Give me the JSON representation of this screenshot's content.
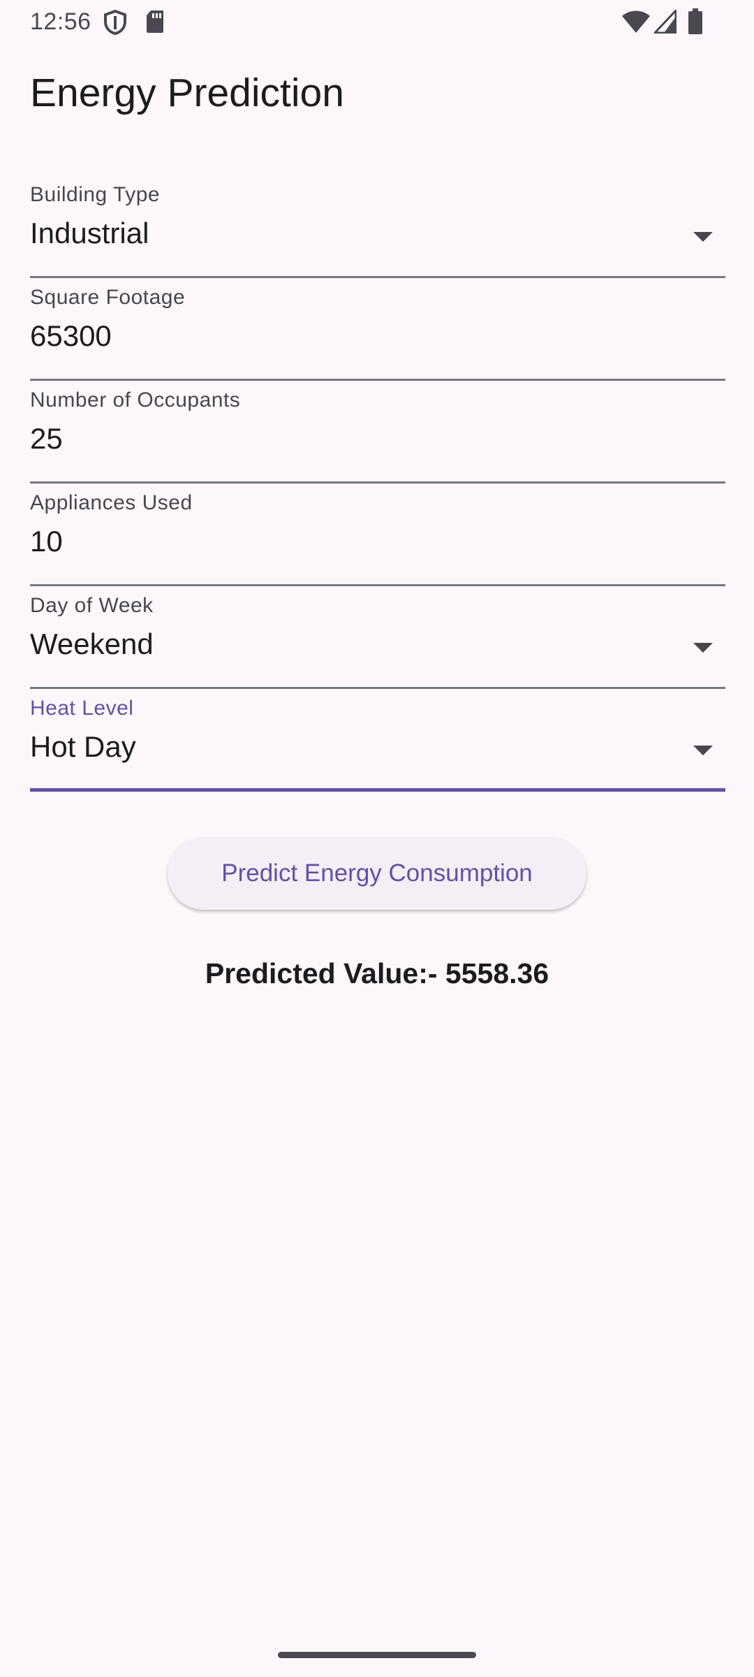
{
  "status_bar": {
    "time": "12:56",
    "icons": [
      "shield-icon",
      "sd-card-icon",
      "wifi-icon",
      "signal-icon",
      "battery-icon"
    ]
  },
  "app_bar": {
    "title": "Energy Prediction"
  },
  "form": {
    "building_type": {
      "label": "Building Type",
      "value": "Industrial"
    },
    "square_footage": {
      "label": "Square Footage",
      "value": "65300"
    },
    "occupants": {
      "label": "Number of Occupants",
      "value": "25"
    },
    "appliances": {
      "label": "Appliances Used",
      "value": "10"
    },
    "day_of_week": {
      "label": "Day of Week",
      "value": "Weekend"
    },
    "heat_level": {
      "label": "Heat Level",
      "value": "Hot Day"
    }
  },
  "actions": {
    "predict_label": "Predict Energy Consumption"
  },
  "result": {
    "text": "Predicted Value:- 5558.36"
  },
  "colors": {
    "background": "#fdf7fc",
    "accent": "#6550a4",
    "text": "#1d1b20",
    "underline": "#7a7680"
  }
}
